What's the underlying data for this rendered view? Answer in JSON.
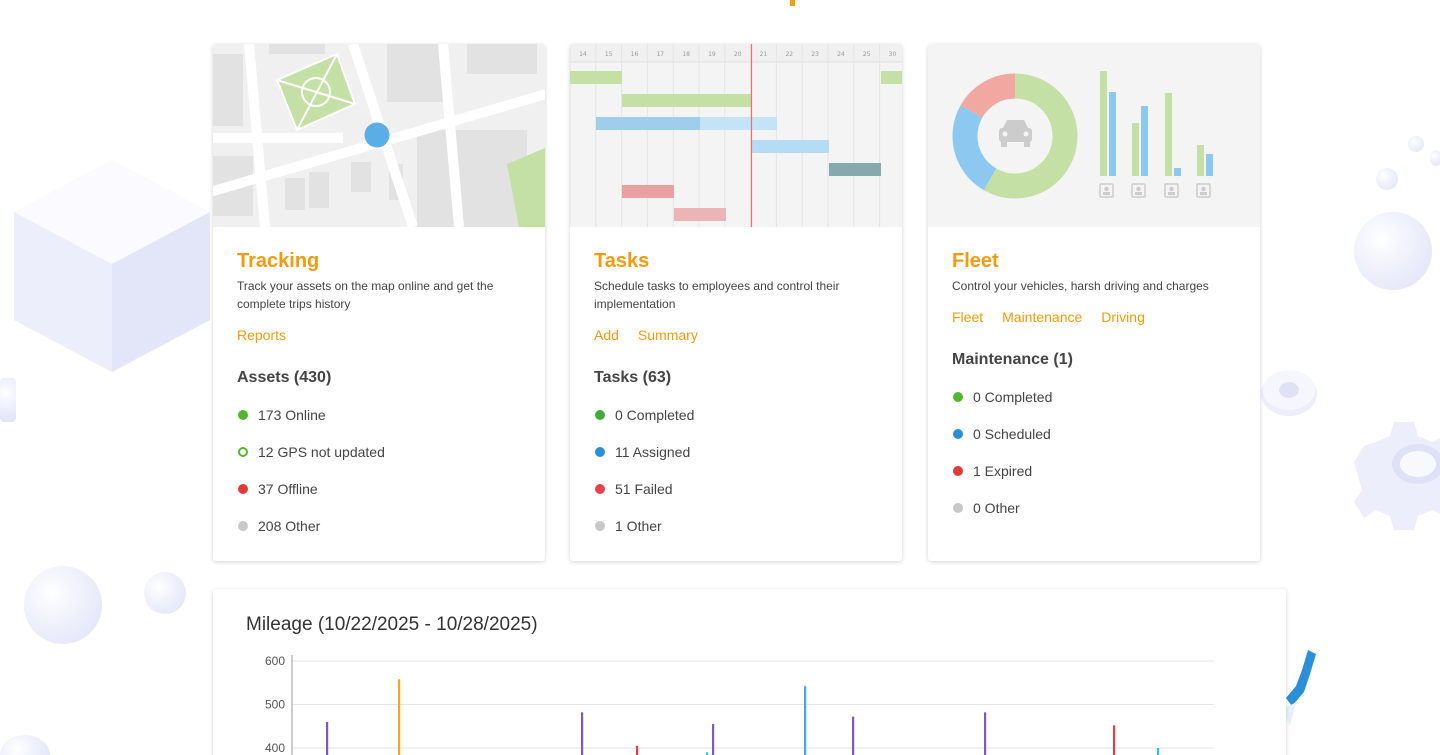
{
  "cards": {
    "tracking": {
      "title": "Tracking",
      "description": "Track your assets on the map online and get the complete trips history",
      "links": [
        "Reports"
      ],
      "section": "Assets (430)",
      "stats": [
        {
          "label": "173 Online",
          "color": "#52b72d",
          "style": "filled"
        },
        {
          "label": "12 GPS not updated",
          "color": "#52b72d",
          "style": "ring"
        },
        {
          "label": "37 Offline",
          "color": "#e03a3a",
          "style": "filled"
        },
        {
          "label": "208 Other",
          "color": "#c8c8c8",
          "style": "filled"
        }
      ]
    },
    "tasks": {
      "title": "Tasks",
      "description": "Schedule tasks to employees and control their implementation",
      "links": [
        "Add",
        "Summary"
      ],
      "section": "Tasks (63)",
      "gantt_days": [
        "14",
        "15",
        "16",
        "17",
        "18",
        "19",
        "20",
        "21",
        "22",
        "23",
        "24",
        "25",
        "30"
      ],
      "stats": [
        {
          "label": "0 Completed",
          "color": "#46ab3c",
          "style": "filled"
        },
        {
          "label": "11 Assigned",
          "color": "#2b8fd6",
          "style": "filled"
        },
        {
          "label": "51 Failed",
          "color": "#e8414c",
          "style": "filled"
        },
        {
          "label": "1 Other",
          "color": "#c8c8c8",
          "style": "filled"
        }
      ]
    },
    "fleet": {
      "title": "Fleet",
      "description": "Control your vehicles, harsh driving and charges",
      "links": [
        "Fleet",
        "Maintenance",
        "Driving"
      ],
      "section": "Maintenance (1)",
      "stats": [
        {
          "label": "0 Completed",
          "color": "#52b72d",
          "style": "filled"
        },
        {
          "label": "0 Scheduled",
          "color": "#2b8fd6",
          "style": "filled"
        },
        {
          "label": "1 Expired",
          "color": "#e03a3a",
          "style": "filled"
        },
        {
          "label": "0 Other",
          "color": "#c8c8c8",
          "style": "filled"
        }
      ]
    }
  },
  "chart_data": {
    "type": "bar",
    "title": "Mileage (10/22/2025 - 10/28/2025)",
    "ylim": [
      0,
      600
    ],
    "y_ticks": [
      600,
      500,
      400
    ],
    "grid": true,
    "series": [
      {
        "values": [
          460
        ],
        "color": "#7e57c2"
      },
      {
        "values": [
          558
        ],
        "color": "#f5a623"
      },
      {
        "values": [
          482
        ],
        "color": "#7e57c2"
      },
      {
        "values": [
          405
        ],
        "color": "#e53950"
      },
      {
        "values": [
          390
        ],
        "color": "#26c6da"
      },
      {
        "values": [
          455
        ],
        "color": "#7e57c2"
      },
      {
        "values": [
          542
        ],
        "color": "#42a5f5"
      },
      {
        "values": [
          472
        ],
        "color": "#7e57c2"
      },
      {
        "values": [
          482
        ],
        "color": "#7e57c2"
      },
      {
        "values": [
          452
        ],
        "color": "#e53950"
      },
      {
        "values": [
          400
        ],
        "color": "#26c6da"
      }
    ]
  },
  "colors": {
    "accent": "#f59a0c"
  }
}
